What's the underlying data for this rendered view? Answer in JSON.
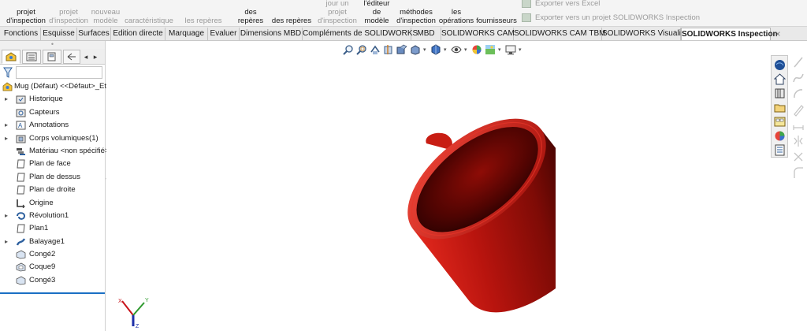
{
  "ribbon": {
    "buttons": [
      {
        "label": "projet\nd'inspection",
        "disabled": false
      },
      {
        "label": "projet\nd'inspection",
        "disabled": true
      },
      {
        "label": "nouveau\nmodèle",
        "disabled": true
      },
      {
        "label": "caractéristique",
        "disabled": true
      },
      {
        "label": "les repères",
        "disabled": true
      },
      {
        "label": "des\nrepères",
        "disabled": false
      },
      {
        "label": "des repères",
        "disabled": false
      },
      {
        "label": "jour un\nprojet\nd'inspection",
        "disabled": true
      },
      {
        "label": "l'éditeur\nde\nmodèle",
        "disabled": false
      },
      {
        "label": "méthodes\nd'inspection",
        "disabled": false
      },
      {
        "label": "les\nopérations",
        "disabled": false
      },
      {
        "label": "fournisseurs",
        "disabled": false
      }
    ],
    "export_excel": "Exporter vers Excel",
    "export_project": "Exporter vers un projet SOLIDWORKS Inspection"
  },
  "tabs": [
    {
      "label": "Fonctions",
      "active": false
    },
    {
      "label": "Esquisse",
      "active": false
    },
    {
      "label": "Surfaces",
      "active": false
    },
    {
      "label": "Edition directe",
      "active": false
    },
    {
      "label": "Marquage",
      "active": false
    },
    {
      "label": "Evaluer",
      "active": false
    },
    {
      "label": "Dimensions MBD",
      "active": false
    },
    {
      "label": "Compléments de SOLIDWORKS",
      "active": false
    },
    {
      "label": "MBD",
      "active": false
    },
    {
      "label": "SOLIDWORKS CAM",
      "active": false
    },
    {
      "label": "SOLIDWORKS CAM TBM",
      "active": false
    },
    {
      "label": "SOLIDWORKS Visualize",
      "active": false
    },
    {
      "label": "SOLIDWORKS Inspection",
      "active": true
    }
  ],
  "tab_close": "×",
  "feature_tree": {
    "root": "Mug (Défaut) <<Défaut>_Et",
    "items": [
      {
        "label": "Historique",
        "expand": true,
        "icon": "history-folder-icon"
      },
      {
        "label": "Capteurs",
        "expand": false,
        "icon": "sensor-icon"
      },
      {
        "label": "Annotations",
        "expand": true,
        "icon": "annotation-icon"
      },
      {
        "label": "Corps volumiques(1)",
        "expand": true,
        "icon": "solid-bodies-icon"
      },
      {
        "label": "Matériau <non spécifié>",
        "expand": false,
        "icon": "material-icon"
      },
      {
        "label": "Plan de face",
        "expand": false,
        "icon": "plane-icon"
      },
      {
        "label": "Plan de dessus",
        "expand": false,
        "icon": "plane-icon"
      },
      {
        "label": "Plan de droite",
        "expand": false,
        "icon": "plane-icon"
      },
      {
        "label": "Origine",
        "expand": false,
        "icon": "origin-icon"
      },
      {
        "label": "Révolution1",
        "expand": true,
        "icon": "revolve-icon"
      },
      {
        "label": "Plan1",
        "expand": false,
        "icon": "plane-icon"
      },
      {
        "label": "Balayage1",
        "expand": true,
        "icon": "sweep-icon"
      },
      {
        "label": "Congé2",
        "expand": false,
        "icon": "fillet-icon"
      },
      {
        "label": "Coque9",
        "expand": false,
        "icon": "shell-icon"
      },
      {
        "label": "Congé3",
        "expand": false,
        "icon": "fillet-icon"
      }
    ]
  },
  "triad": {
    "x": "X",
    "y": "Y",
    "z": "Z"
  },
  "colors": {
    "mug_red": "#b8140e",
    "mug_dark": "#5c0603",
    "accent_blue": "#1a6fc4",
    "active_tab_bg": "#ffffff"
  },
  "task_pane_icons": [
    "resources-icon",
    "home-icon",
    "design-library-icon",
    "file-explorer-icon",
    "view-palette-icon",
    "appearances-icon",
    "custom-properties-icon"
  ]
}
